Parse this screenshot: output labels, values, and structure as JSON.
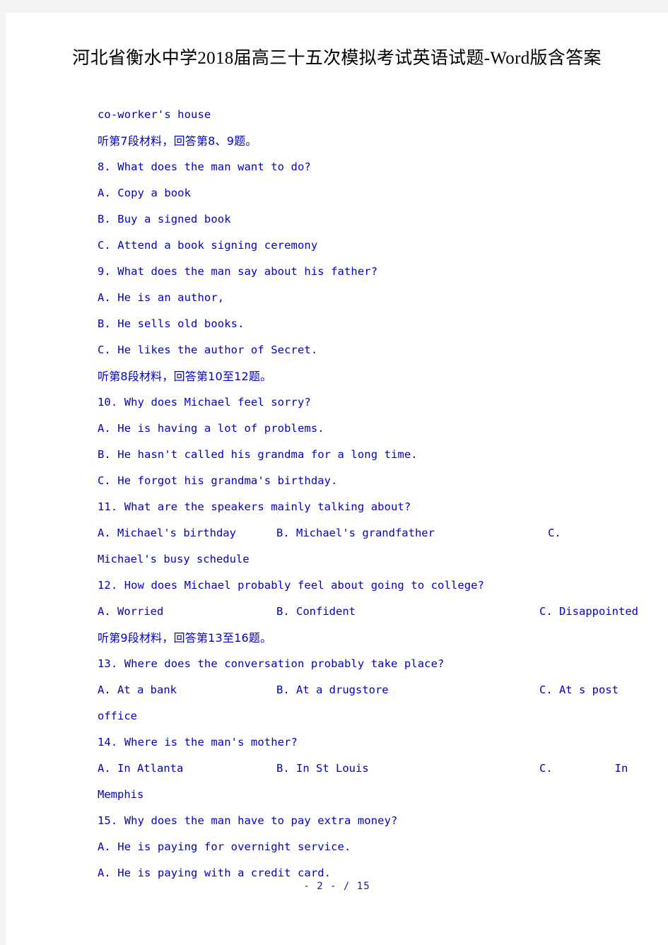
{
  "document": {
    "title": "河北省衡水中学2018届高三十五次模拟考试英语试题-Word版含答案",
    "footer": "- 2 - / 15",
    "text_color": "#0000cc",
    "title_color": "#000000",
    "footer_color": "#1a1a8c",
    "page_background": "#ffffff",
    "canvas_background": "#f4f4f4"
  },
  "content": {
    "carryover_line": "co-worker's house",
    "section_7_heading": "听第7段材料，回答第8、9题。",
    "q8_stem": "8. What does the man want to do?",
    "q8_a": "A. Copy a book",
    "q8_b": "B. Buy a signed book",
    "q8_c": "C. Attend a book signing ceremony",
    "q9_stem": "9. What does the man say about his father?",
    "q9_a": "A. He is an author,",
    "q9_b": "B. He sells old books.",
    "q9_c": "C. He likes the author of Secret.",
    "section_8_heading": "听第8段材料，回答第10至12题。",
    "q10_stem": "10. Why does Michael feel sorry?",
    "q10_a": "A. He is having a lot of problems.",
    "q10_b": "B. He hasn't called his grandma for a long time.",
    "q10_c": "C. He forgot his grandma's birthday.",
    "q11_stem": "11. What are the speakers mainly talking about?",
    "q11_a": "A. Michael's birthday",
    "q11_b": "B. Michael's grandfather",
    "q11_c": "C.",
    "q11_c_wrap": "Michael's busy schedule",
    "q12_stem": "12. How does Michael probably feel about going to college?",
    "q12_a": "A. Worried",
    "q12_b": "B. Confident",
    "q12_c": "C. Disappointed",
    "section_9_heading": "听第9段材料，回答第13至16题。",
    "q13_stem": "13. Where does the conversation probably take place?",
    "q13_a": "A. At a bank",
    "q13_b": "B. At a drugstore",
    "q13_c": "C. At s post",
    "q13_c_wrap": "office",
    "q14_stem": "14. Where is the man's mother?",
    "q14_a": "A. In Atlanta",
    "q14_b": "B. In St Louis",
    "q14_c_label": "C.",
    "q14_c_value": "In",
    "q14_c_wrap": "Memphis",
    "q15_stem": "15. Why does the man have to pay extra money?",
    "q15_a": "A. He is paying for overnight service.",
    "q15_b": "A. He is paying with a credit card."
  }
}
